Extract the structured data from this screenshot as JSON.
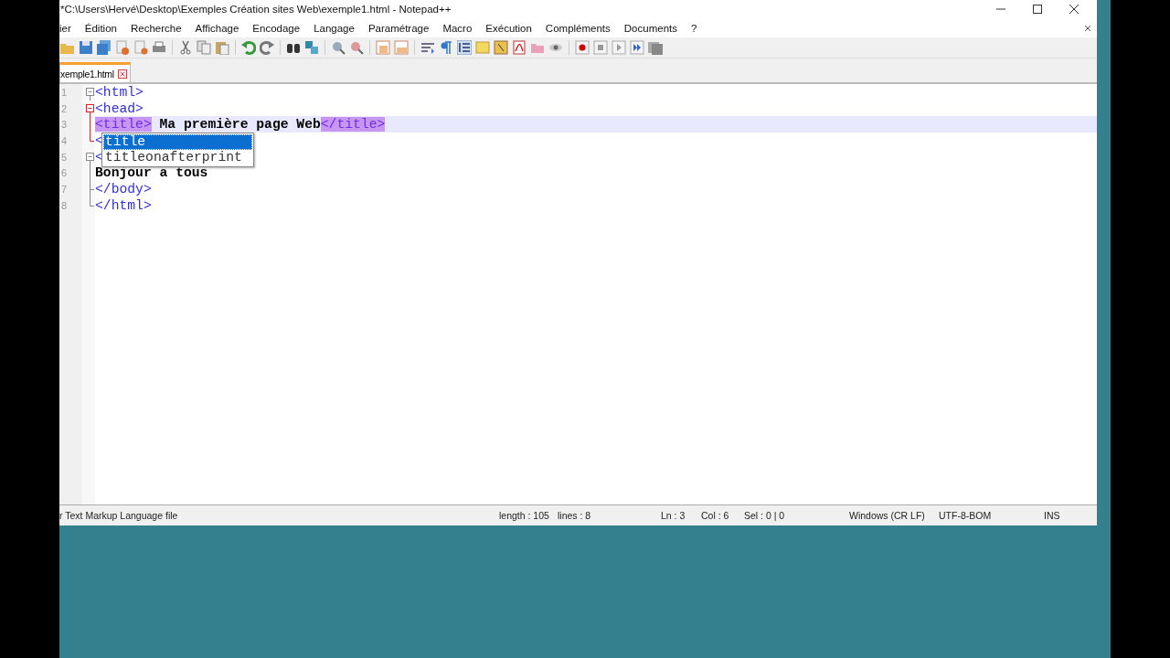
{
  "window": {
    "title": "*C:\\Users\\Hervé\\Desktop\\Exemples Création sites Web\\exemple1.html - Notepad++"
  },
  "menu": [
    "ier",
    "Édition",
    "Recherche",
    "Affichage",
    "Encodage",
    "Langage",
    "Paramétrage",
    "Macro",
    "Exécution",
    "Compléments",
    "Documents",
    "?"
  ],
  "tabs": [
    {
      "label": "xemple1.html",
      "selected": true
    }
  ],
  "editor": {
    "lines": [
      {
        "number": "1",
        "kind": "head",
        "current": false,
        "tokens": [
          {
            "text": "<html>",
            "kind": "tag",
            "highlighted": false
          }
        ]
      },
      {
        "number": "2",
        "kind": "head-active",
        "current": false,
        "tokens": [
          {
            "text": "<head>",
            "kind": "tag",
            "highlighted": false
          }
        ]
      },
      {
        "number": "3",
        "kind": "body-active",
        "current": true,
        "tokens": [
          {
            "text": "<title>",
            "kind": "tag",
            "highlighted": true
          },
          {
            "text": " Ma première page Web",
            "kind": "text",
            "highlighted": false
          },
          {
            "text": "</title>",
            "kind": "tag",
            "highlighted": true
          }
        ]
      },
      {
        "number": "4",
        "kind": "tail-active",
        "current": false,
        "tokens": [
          {
            "text": "<",
            "kind": "tag",
            "highlighted": false
          }
        ]
      },
      {
        "number": "5",
        "kind": "head",
        "current": false,
        "tokens": [
          {
            "text": "<",
            "kind": "tag",
            "highlighted": false
          }
        ]
      },
      {
        "number": "6",
        "kind": "body",
        "current": false,
        "tokens": [
          {
            "text": "Bonjour a tous",
            "kind": "text",
            "highlighted": false
          }
        ]
      },
      {
        "number": "7",
        "kind": "tee",
        "current": false,
        "tokens": [
          {
            "text": "</body>",
            "kind": "tag",
            "highlighted": false
          }
        ]
      },
      {
        "number": "8",
        "kind": "tail",
        "current": false,
        "tokens": [
          {
            "text": "</html>",
            "kind": "tag",
            "highlighted": false
          }
        ]
      }
    ],
    "autocomplete": [
      {
        "label": "title",
        "selected": true
      },
      {
        "label": "titleonafterprint",
        "selected": false
      }
    ]
  },
  "status_bar": {
    "file_type": "r Text Markup Language file",
    "length": "length : 105",
    "lines": "lines : 8",
    "ln": "Ln : 3",
    "col": "Col : 6",
    "sel": "Sel : 0 | 0",
    "eol": "Windows (CR LF)",
    "encoding": "UTF-8-BOM",
    "mode": "INS"
  }
}
